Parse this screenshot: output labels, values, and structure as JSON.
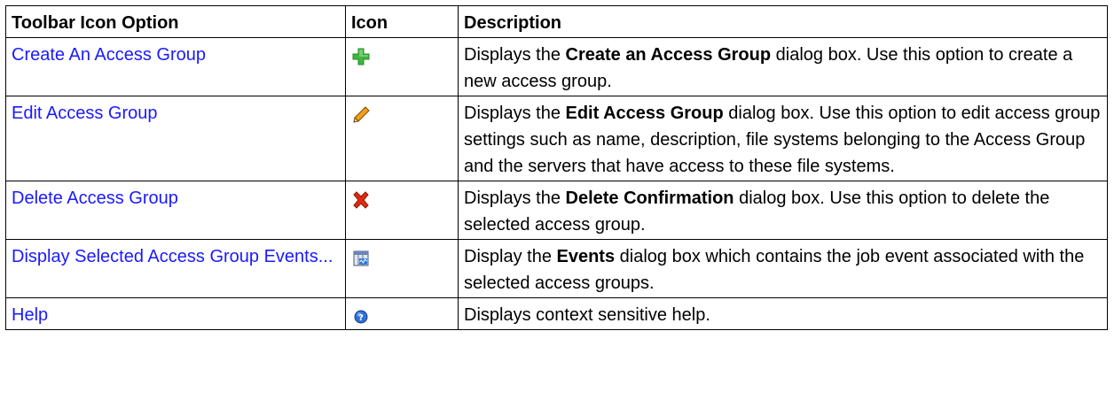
{
  "table": {
    "headers": [
      "Toolbar Icon Option",
      "Icon",
      "Description"
    ],
    "rows": [
      {
        "option": "Create An Access Group",
        "icon": "add-plus-icon",
        "desc_pre": "Displays the ",
        "desc_bold": "Create an Access Group",
        "desc_post": " dialog box. Use this option to create a new access group."
      },
      {
        "option": "Edit Access Group",
        "icon": "pencil-edit-icon",
        "desc_pre": "Displays the ",
        "desc_bold": "Edit Access Group",
        "desc_post": " dialog box. Use this option to edit access group settings such as name, description, file systems belonging to the Access Group and the servers that have access to these file systems."
      },
      {
        "option": "Delete Access Group",
        "icon": "delete-x-icon",
        "desc_pre": "Displays the ",
        "desc_bold": "Delete Confirmation",
        "desc_post": " dialog box. Use this option to delete the selected access group."
      },
      {
        "option": "Display Selected Access Group Events...",
        "icon": "events-icon",
        "desc_pre": "Display the ",
        "desc_bold": "Events",
        "desc_post": " dialog box which contains the job event associated with the selected access groups."
      },
      {
        "option": "Help",
        "icon": "help-icon",
        "desc_pre": "Displays context sensitive help.",
        "desc_bold": "",
        "desc_post": ""
      }
    ]
  },
  "colors": {
    "link": "#1a1aff",
    "border": "#000000",
    "plus_green": "#3fb53f",
    "delete_red": "#e02a10",
    "help_blue": "#2f6fd8"
  }
}
